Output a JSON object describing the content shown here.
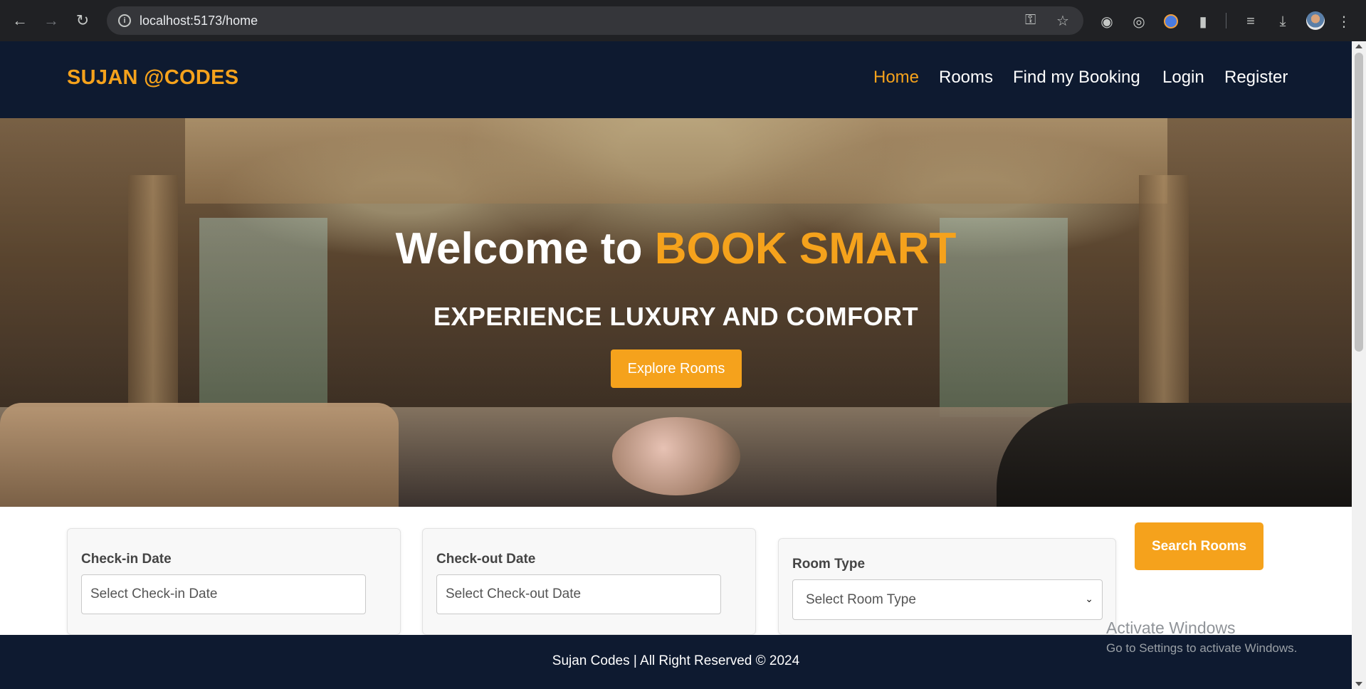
{
  "browser": {
    "url": "localhost:5173/home",
    "icons": [
      "back-arrow-icon",
      "forward-arrow-icon",
      "reload-icon",
      "site-info-icon",
      "password-key-icon",
      "bookmark-star-icon",
      "screenshot-icon",
      "record-icon",
      "extension-shield-icon",
      "extensions-puzzle-icon",
      "media-queue-icon",
      "download-icon",
      "profile-avatar",
      "menu-kebab-icon"
    ]
  },
  "header": {
    "logo": "SUJAN @CODES",
    "nav": [
      {
        "label": "Home",
        "active": true
      },
      {
        "label": "Rooms",
        "active": false
      },
      {
        "label": "Find my Booking",
        "active": false
      },
      {
        "label": "Login",
        "active": false
      },
      {
        "label": "Register",
        "active": false
      }
    ]
  },
  "hero": {
    "title_prefix": "Welcome to",
    "title_accent": "BOOK SMART",
    "subtitle": "EXPERIENCE LUXURY AND COMFORT",
    "cta_label": "Explore Rooms"
  },
  "search": {
    "checkin_label": "Check-in Date",
    "checkin_placeholder": "Select Check-in Date",
    "checkout_label": "Check-out Date",
    "checkout_placeholder": "Select Check-out Date",
    "roomtype_label": "Room Type",
    "roomtype_selected": "Select Room Type",
    "button_label": "Search Rooms"
  },
  "footer": {
    "text": "Sujan Codes | All Right Reserved © 2024"
  },
  "watermark": {
    "title": "Activate Windows",
    "subtitle": "Go to Settings to activate Windows."
  },
  "colors": {
    "accent": "#f5a21c",
    "navy": "#0e1a30"
  }
}
